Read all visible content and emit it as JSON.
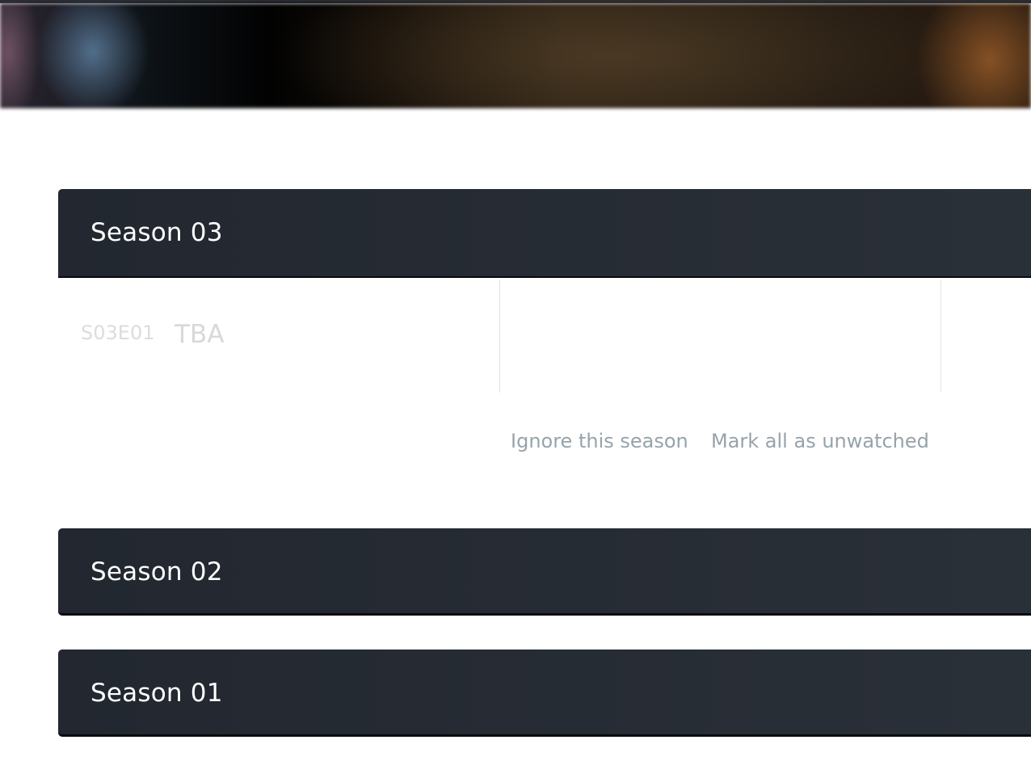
{
  "seasons": [
    {
      "title": "Season 03",
      "expanded": true
    },
    {
      "title": "Season 02",
      "expanded": false
    },
    {
      "title": "Season 01",
      "expanded": false
    }
  ],
  "season03": {
    "episodes": [
      {
        "code": "S03E01",
        "title": "TBA"
      }
    ],
    "actions": {
      "ignore_label": "Ignore this season",
      "unwatch_label": "Mark all as unwatched"
    }
  },
  "colors": {
    "season_bar": "#262b33",
    "action_text": "#96a3ab",
    "episode_text": "#d8d8d8"
  }
}
